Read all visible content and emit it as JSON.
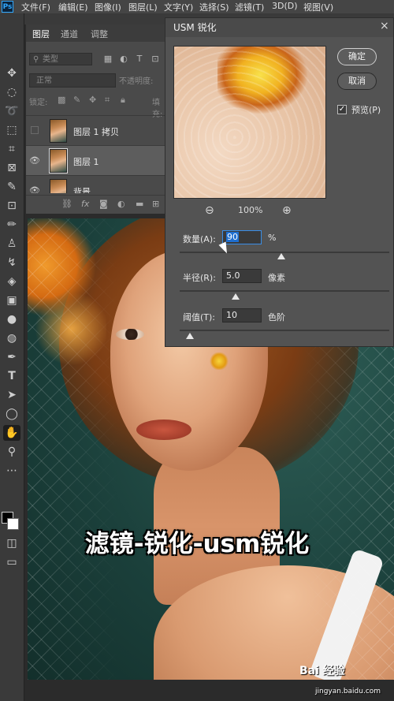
{
  "menubar": {
    "logo": "Ps",
    "items": [
      "文件(F)",
      "编辑(E)",
      "图像(I)",
      "图层(L)",
      "文字(Y)",
      "选择(S)",
      "滤镜(T)",
      "3D(D)",
      "视图(V)"
    ]
  },
  "toolbar": {
    "tools": [
      "move-tool-icon",
      "marquee-tool-icon",
      "lasso-tool-icon",
      "quick-select-tool-icon",
      "crop-tool-icon",
      "frame-tool-icon",
      "eyedropper-tool-icon",
      "healing-tool-icon",
      "brush-tool-icon",
      "stamp-tool-icon",
      "history-brush-icon",
      "eraser-tool-icon",
      "gradient-tool-icon",
      "blur-tool-icon",
      "dodge-tool-icon",
      "pen-tool-icon",
      "type-tool-icon",
      "path-select-tool-icon",
      "shape-tool-icon",
      "hand-tool-icon",
      "zoom-tool-icon",
      "more-tools-icon"
    ],
    "type_glyph": "T"
  },
  "layers_panel": {
    "tabs": [
      "图层",
      "通道",
      "调整"
    ],
    "kind_placeholder": "类型",
    "blend_mode": "正常",
    "opacity_label": "不透明度:",
    "lock_label": "锁定:",
    "fill_label": "填充:",
    "layers": [
      {
        "name": "图层 1 拷贝",
        "visible": false,
        "selected": false
      },
      {
        "name": "图层 1",
        "visible": true,
        "selected": true
      },
      {
        "name": "背景",
        "visible": true,
        "selected": false
      }
    ],
    "footer_fx": "fx"
  },
  "dialog": {
    "title": "USM 锐化",
    "close": "×",
    "ok_label": "确定",
    "cancel_label": "取消",
    "preview_label": "预览(P)",
    "preview_checked": true,
    "zoom_level": "100%",
    "amount_label": "数量(A):",
    "amount_value": "90",
    "amount_unit": "%",
    "radius_label": "半径(R):",
    "radius_value": "5.0",
    "radius_unit": "像素",
    "threshold_label": "阈值(T):",
    "threshold_value": "10",
    "threshold_unit": "色阶"
  },
  "caption": "滤镜-锐化-usm锐化",
  "watermark": {
    "brand": "Bai 经验",
    "url": "jingyan.baidu.com"
  }
}
